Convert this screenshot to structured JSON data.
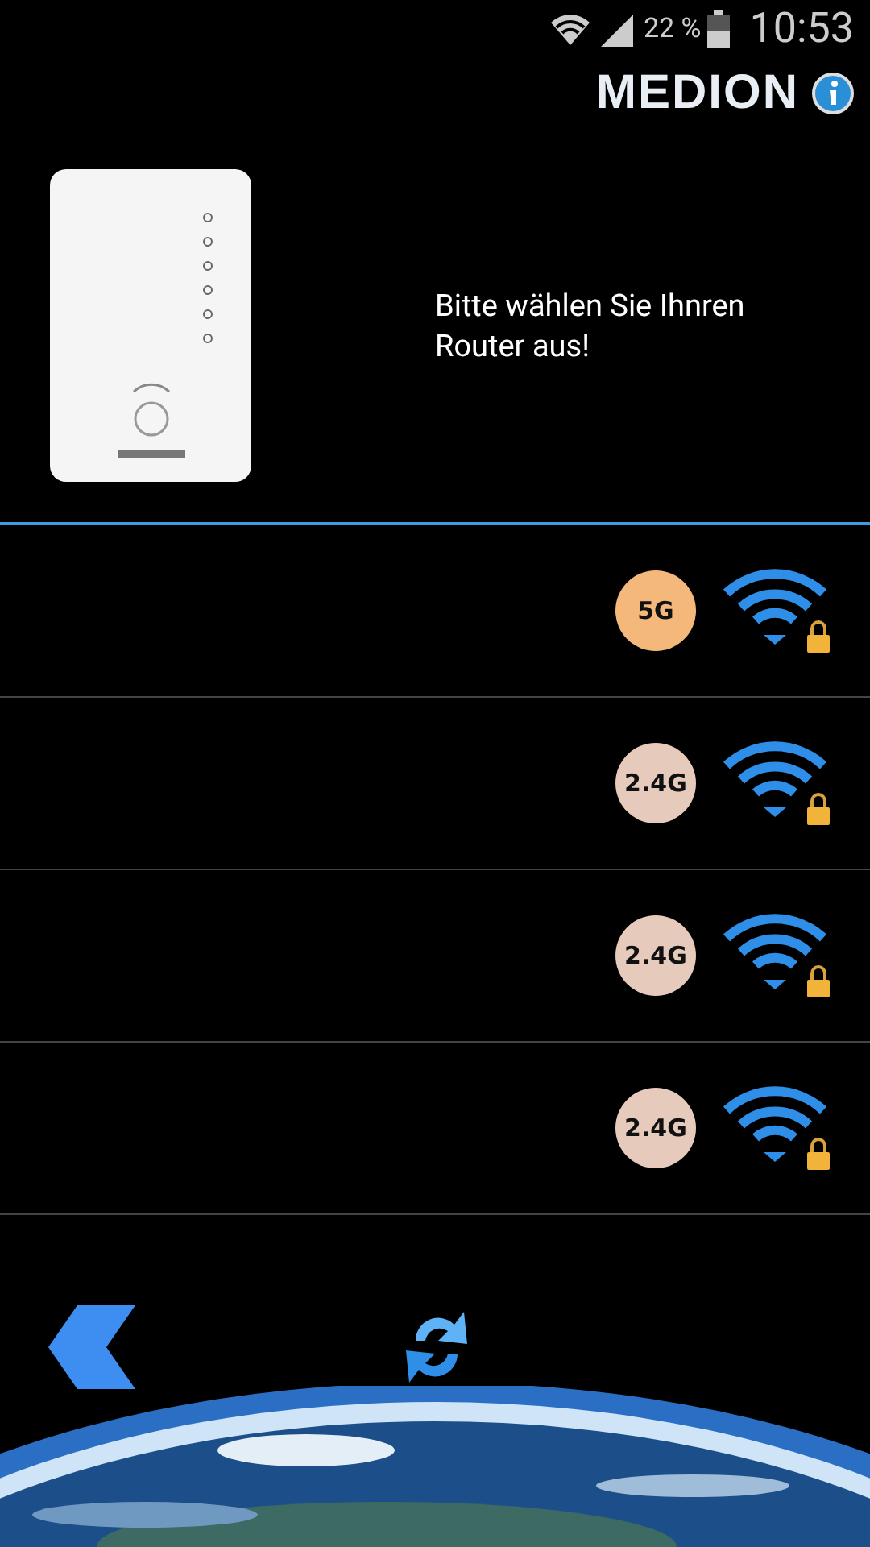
{
  "status_bar": {
    "battery": "22 %",
    "time": "10:53"
  },
  "header": {
    "logo": "MEDION"
  },
  "device": {
    "prompt": "Bitte wählen Sie Ihnren Router aus!"
  },
  "networks": [
    {
      "band": "5G",
      "color": "#f4b87a",
      "locked": true
    },
    {
      "band": "2.4G",
      "color": "#e6cbbd",
      "locked": true
    },
    {
      "band": "2.4G",
      "color": "#e6cbbd",
      "locked": true
    },
    {
      "band": "2.4G",
      "color": "#e6cbbd",
      "locked": true
    }
  ]
}
